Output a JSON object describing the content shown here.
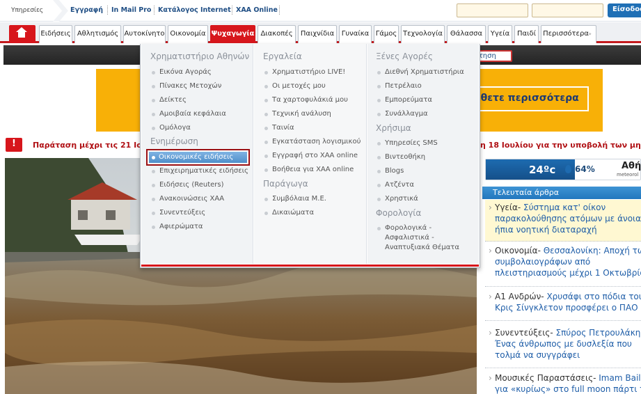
{
  "topbar": {
    "services_label": "Υπηρεσίες",
    "links": [
      "Εγγραφή",
      "In Mail Pro",
      "Κατάλογος Internet",
      "ΧΑΑ Online"
    ],
    "login_label": "Είσοδος"
  },
  "nav": {
    "tabs": [
      "Ειδήσεις",
      "Αθλητισμός",
      "Αυτοκίνητο",
      "Οικονομία",
      "Ψυχαγωγία",
      "Διακοπές",
      "Παιχνίδια",
      "Γυναίκα",
      "Γάμος",
      "Τεχνολογία",
      "Θάλασσα",
      "Υγεία",
      "Παιδί",
      "Περισσότερα"
    ],
    "active_tab": "Ψυχαγωγία",
    "darkband_button": "ζήτηση"
  },
  "ad": {
    "text": "άθετε περισσότερα"
  },
  "ticker": {
    "left": "Παράταση μέχρι τις 21 Ιο",
    "right": "η 18 Ιουλίου για την υποβολή των μη"
  },
  "dropdown": {
    "col1": {
      "heading1": "Χρηματιστήριο Αθηνών",
      "items1": [
        "Εικόνα Αγοράς",
        "Πίνακες Μετοχών",
        "Δείκτες",
        "Αμοιβαία κεφάλαια",
        "Ομόλογα"
      ],
      "heading2": "Ενημέρωση",
      "selected": "Οικονομικές ειδήσεις",
      "items2": [
        "Επιχειρηματικές ειδήσεις",
        "Ειδήσεις (Reuters)",
        "Ανακοινώσεις ΧΑΑ",
        "Συνεντεύξεις",
        "Αφιερώματα"
      ]
    },
    "col2": {
      "heading1": "Εργαλεία",
      "items1": [
        "Χρηματιστήριο LIVE!",
        "Οι μετοχές μου",
        "Τα χαρτοφυλάκιά μου",
        "Τεχνική ανάλυση",
        "Ταινία",
        "Εγκατάσταση λογισμικού",
        "Εγγραφή στο ΧΑΑ online",
        "Βοήθεια για ΧΑΑ online"
      ],
      "heading2": "Παράγωγα",
      "items2": [
        "Συμβόλαια Μ.Ε.",
        "Δικαιώματα"
      ]
    },
    "col3": {
      "heading1": "Ξένες Αγορές",
      "items1": [
        "Διεθνή Χρηματιστήρια",
        "Πετρέλαιο",
        "Εμπορεύματα",
        "Συνάλλαγμα"
      ],
      "heading2": "Χρήσιμα",
      "items2": [
        "Υπηρεσίες SMS",
        "Βιντεοθήκη",
        "Blogs",
        "Ατζέντα",
        "Χρηστικά"
      ],
      "heading3": "Φορολογία",
      "items3": [
        "Φορολογικά -",
        "Ασφαλιστικά -",
        "Αναπτυξιακά Θέματα"
      ]
    }
  },
  "weather": {
    "temp": "24ºc",
    "humidity": "64%",
    "city": "Αθήν",
    "brand": "meteorol"
  },
  "latest": {
    "heading": "Τελευταία άρθρα",
    "articles": [
      {
        "cat": "Υγεία-",
        "lines": [
          "Υγεία- Σύστημα κατ' οίκον",
          "παρακολούθησης ατόμων με άνοια",
          "ήπια νοητική διαταραχή"
        ]
      },
      {
        "cat": "Οικονομία-",
        "lines": [
          "Οικονομία- Θεσσαλονίκη: Αποχή τω",
          "συμβολαιογράφων από",
          "πλειστηριασμούς μέχρι 1 Οκτωβρίο"
        ]
      },
      {
        "cat": "A1 Ανδρών-",
        "lines": [
          "A1 Ανδρών- Χρυσάφι στο πόδια του",
          "Κρις Σίνγκλετον προσφέρει ο ΠΑΟ"
        ]
      },
      {
        "cat": "Συνεντεύξεις-",
        "lines": [
          "Συνεντεύξεις- Σπύρος Πετρουλάκης",
          "Ένας άνθρωπος με δυσλεξία που",
          "τολμά να συγγράφει"
        ]
      },
      {
        "cat": "Μουσικές Παραστάσεις-",
        "lines": [
          "Μουσικές Παραστάσεις- Imam Baild",
          "για «κυρίως» στο full moon πάρτι τ"
        ]
      }
    ]
  }
}
